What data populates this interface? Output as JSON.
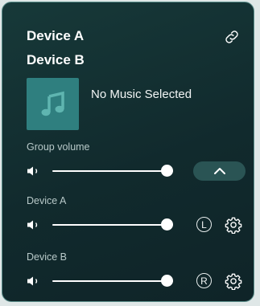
{
  "header": {
    "device_a_title": "Device A",
    "device_b_title": "Device B",
    "link_icon": "link-icon"
  },
  "now_playing": {
    "album_art_icon": "music-note-icon",
    "text": "No Music Selected"
  },
  "group_volume": {
    "label": "Group volume",
    "speaker_icon": "speaker-icon",
    "level": 0.95,
    "collapse_icon": "chevron-up-icon"
  },
  "device_a": {
    "label": "Device A",
    "speaker_icon": "speaker-icon",
    "level": 0.95,
    "channel": "L",
    "settings_icon": "gear-icon"
  },
  "device_b": {
    "label": "Device B",
    "speaker_icon": "speaker-icon",
    "level": 0.95,
    "channel": "R",
    "settings_icon": "gear-icon"
  },
  "colors": {
    "background": "#112a2d",
    "border": "#5c8f8c",
    "album_art": "#2f7f7f",
    "button": "#2a5454",
    "text": "#ffffff",
    "label": "#b8c9c9"
  }
}
